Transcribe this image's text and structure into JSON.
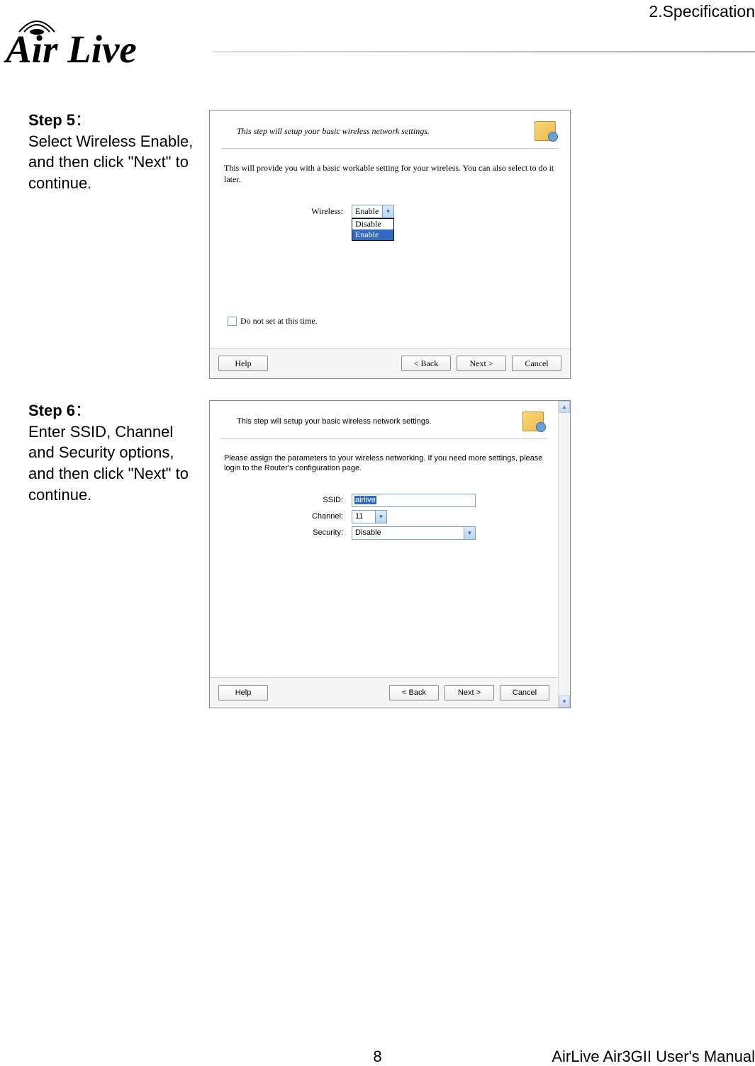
{
  "header": {
    "section": "2.Specification",
    "logo_text": "Air Live",
    "logo_r": "®"
  },
  "step5": {
    "label": "Step 5",
    "colon": "：",
    "instruction": "Select Wireless Enable, and then click \"Next\" to continue.",
    "wizard": {
      "title": "This step will setup your basic wireless network settings.",
      "description": "This will provide you with a basic workable setting for your wireless. You can also select to do it later.",
      "wireless_label": "Wireless:",
      "wireless_selected": "Enable",
      "dropdown_options": [
        "Disable",
        "Enable"
      ],
      "checkbox_label": "Do not set at this time.",
      "buttons": {
        "help": "Help",
        "back": "< Back",
        "next": "Next >",
        "cancel": "Cancel"
      }
    }
  },
  "step6": {
    "label": "Step 6",
    "colon": "：",
    "instruction": "Enter SSID, Channel and Security options, and then click \"Next\" to continue.",
    "wizard": {
      "title": "This step will setup your basic wireless network settings.",
      "description": "Please assign the parameters to your wireless networking. If you need more settings, please login to the Router's configuration page.",
      "ssid_label": "SSID:",
      "ssid_value": "airlive",
      "channel_label": "Channel:",
      "channel_value": "11",
      "security_label": "Security:",
      "security_value": "Disable",
      "buttons": {
        "help": "Help",
        "back": "< Back",
        "next": "Next >",
        "cancel": "Cancel"
      }
    }
  },
  "footer": {
    "page": "8",
    "manual": "AirLive Air3GII User's Manual"
  }
}
